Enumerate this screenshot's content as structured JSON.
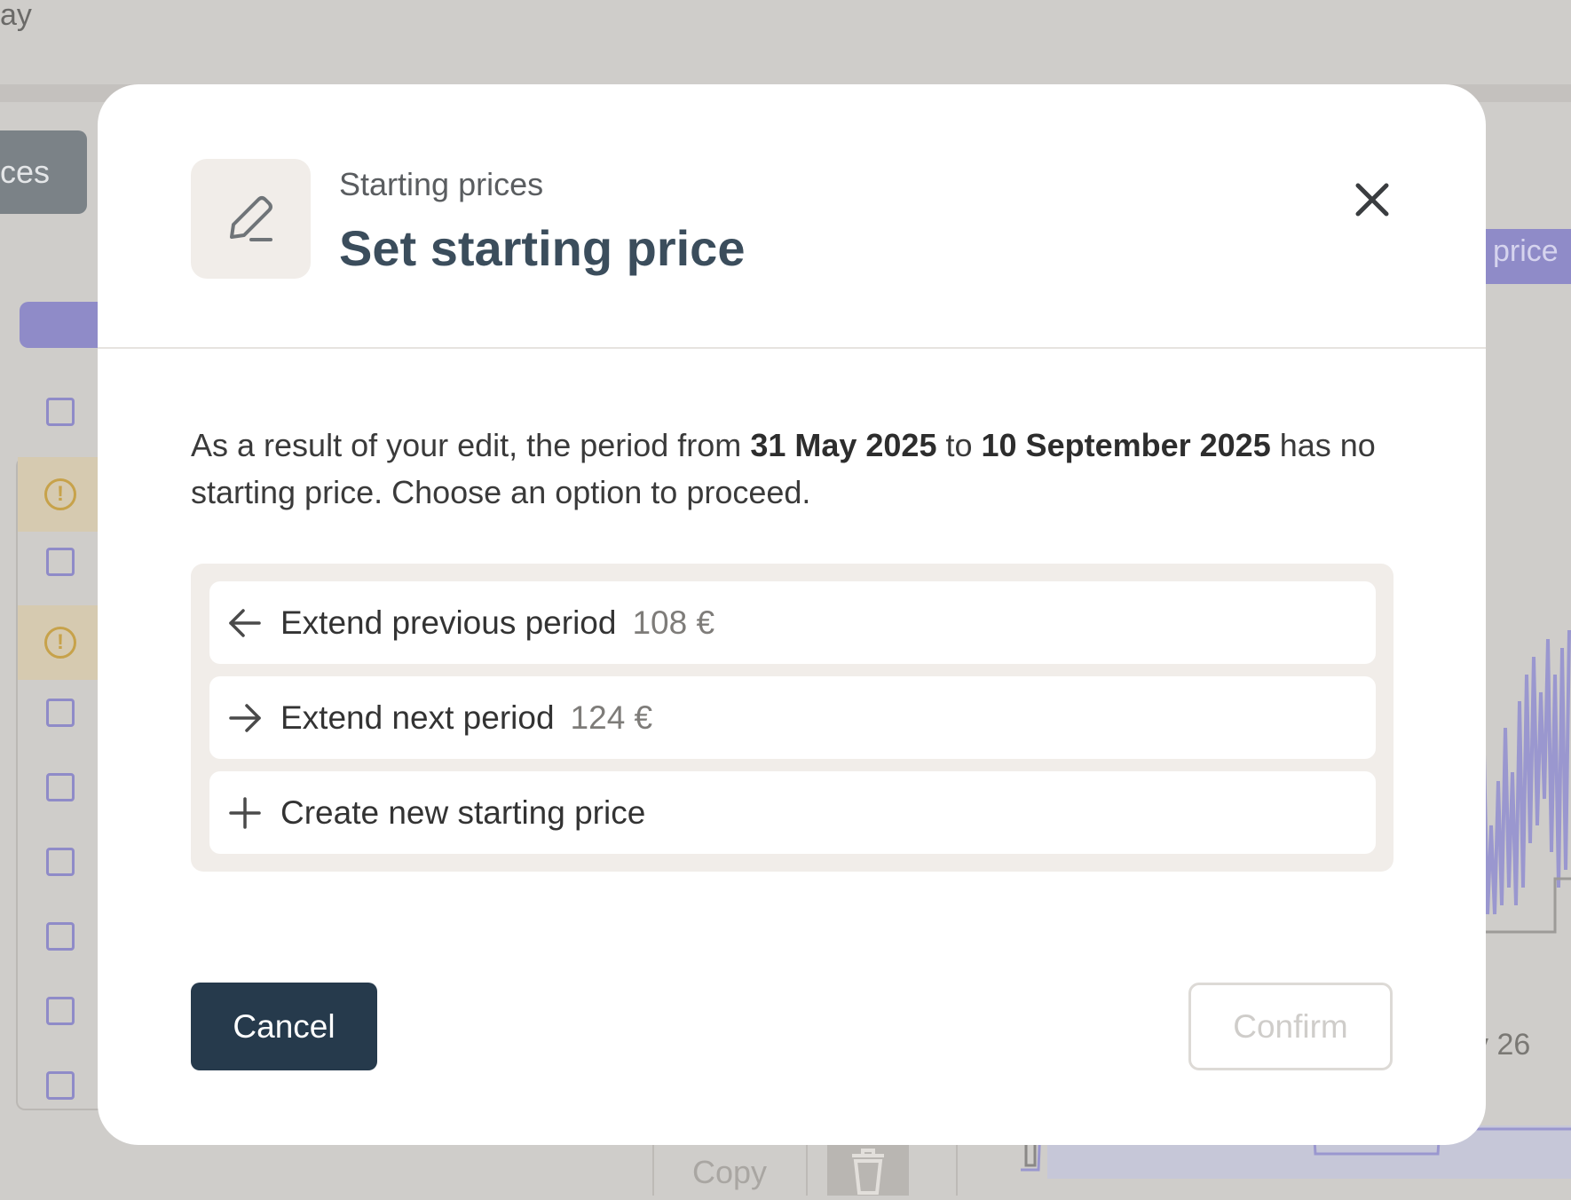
{
  "background": {
    "topbar_fragment": "ay",
    "tab_fragment": "ces",
    "price_badge_fragment": "price",
    "date_fragment": "y 26",
    "copy_label": "Copy"
  },
  "dialog": {
    "subtitle": "Starting prices",
    "title": "Set starting price",
    "header_icon": "pencil-icon",
    "close_icon": "close-icon",
    "message": {
      "prefix": "As a result of your edit, the period from ",
      "start_date": "31 May 2025",
      "middle": " to ",
      "end_date": "10 September 2025",
      "suffix": " has no starting price. Choose an option to proceed."
    },
    "options": [
      {
        "icon": "arrow-left-icon",
        "label": "Extend previous period",
        "price": "108 €"
      },
      {
        "icon": "arrow-right-icon",
        "label": "Extend next period",
        "price": "124 €"
      },
      {
        "icon": "plus-icon",
        "label": "Create new starting price",
        "price": ""
      }
    ],
    "cancel_label": "Cancel",
    "confirm_label": "Confirm"
  },
  "colors": {
    "primary_button": "#263a4c",
    "title": "#3b4d5c",
    "accent_purple": "#8f8bc8",
    "warning": "#c7a24a",
    "backdrop": "#cfcdca"
  }
}
